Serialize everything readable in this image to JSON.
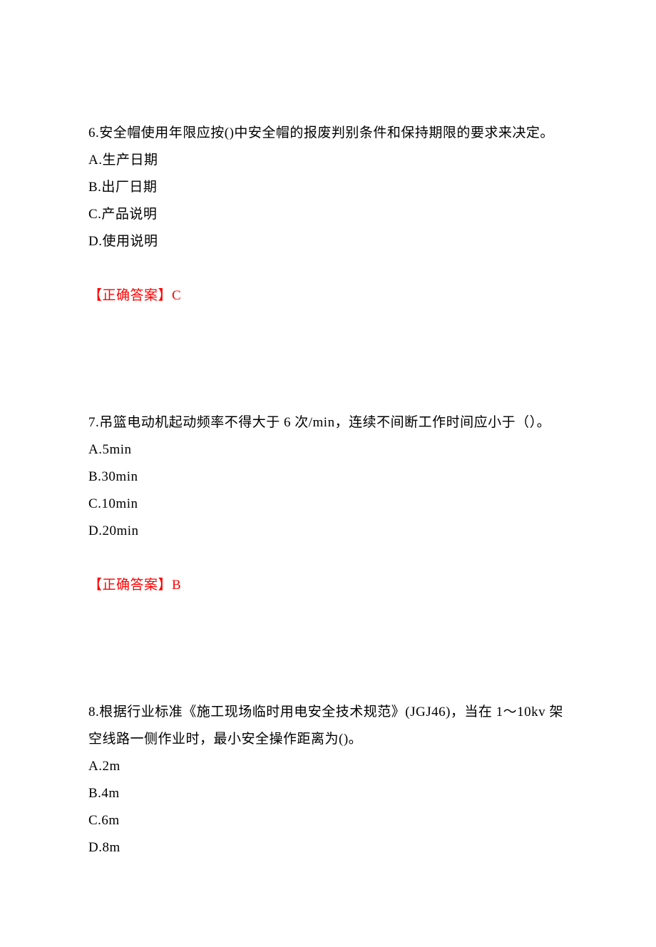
{
  "q6": {
    "stem": "6.安全帽使用年限应按()中安全帽的报废判别条件和保持期限的要求来决定。",
    "optA": "A.生产日期",
    "optB": "B.出厂日期",
    "optC": "C.产品说明",
    "optD": "D.使用说明",
    "ansLabel": "【正确答案】",
    "ansValue": "C"
  },
  "q7": {
    "stem": "7.吊篮电动机起动频率不得大于 6 次/min，连续不间断工作时间应小于（）。",
    "optA": "A.5min",
    "optB": "B.30min",
    "optC": "C.10min",
    "optD": "D.20min",
    "ansLabel": "【正确答案】",
    "ansValue": "B"
  },
  "q8": {
    "stem": "8.根据行业标准《施工现场临时用电安全技术规范》(JGJ46)，当在 1～10kv 架空线路一侧作业时，最小安全操作距离为()。",
    "optA": "A.2m",
    "optB": "B.4m",
    "optC": "C.6m",
    "optD": "D.8m"
  }
}
